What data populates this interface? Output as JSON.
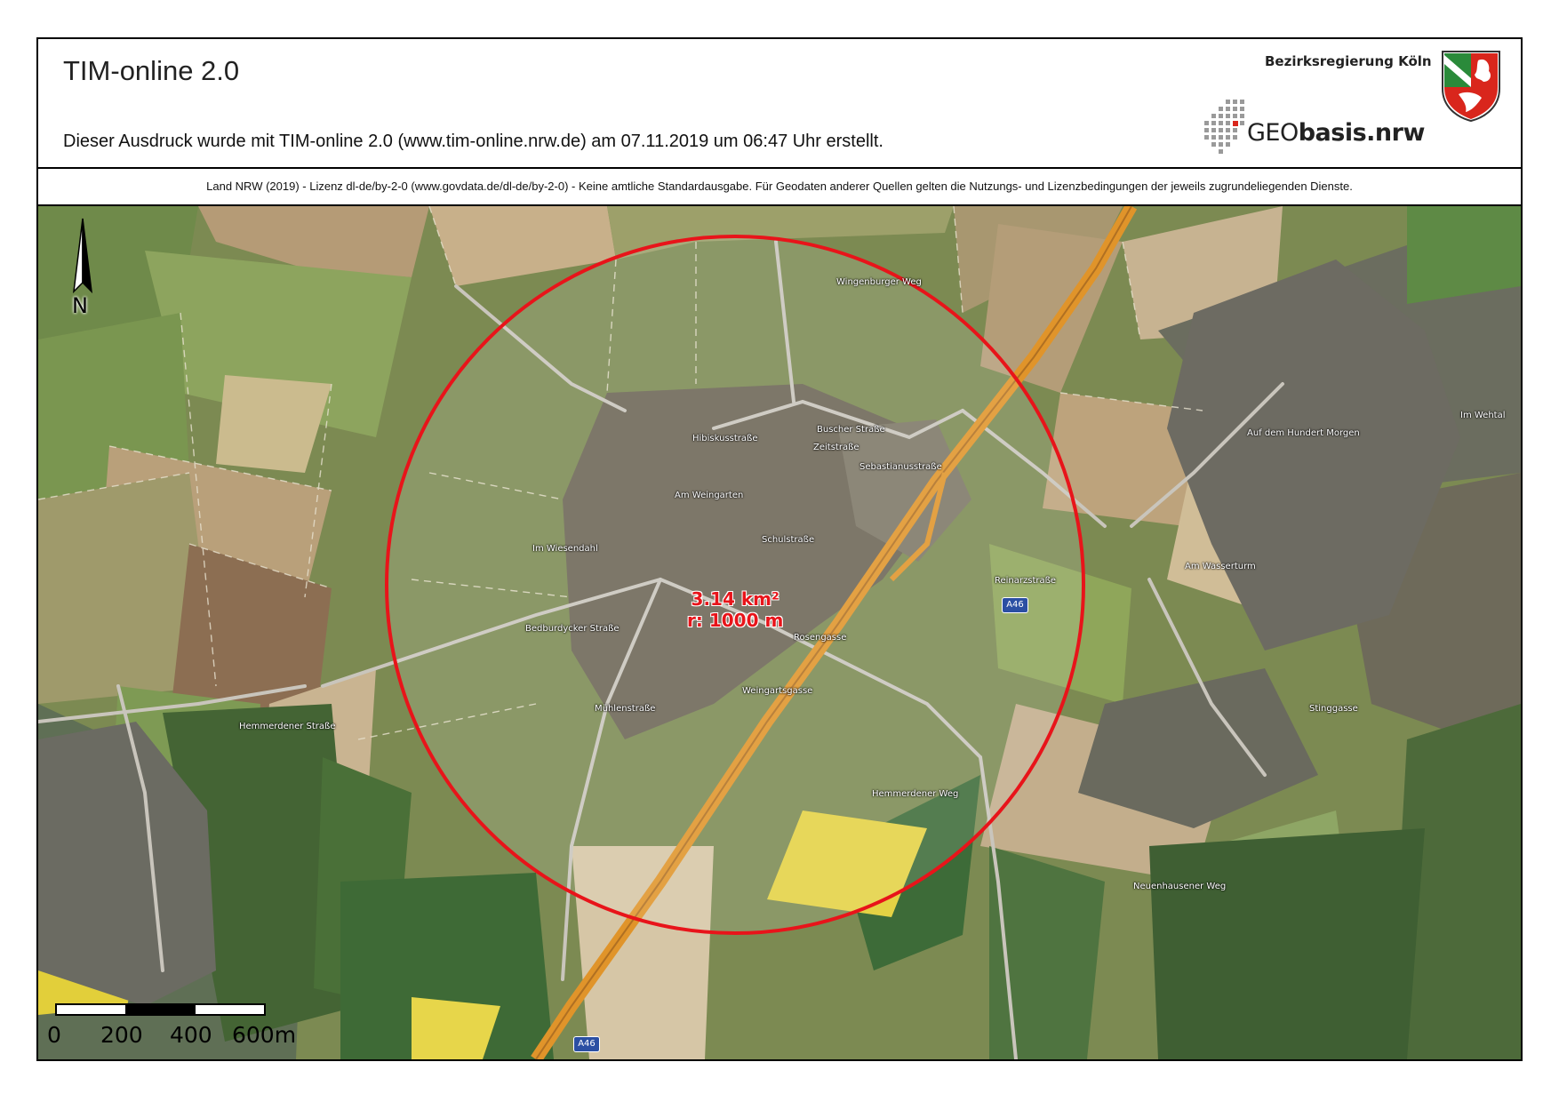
{
  "header": {
    "title": "TIM-online 2.0",
    "subtitle": "Dieser Ausdruck wurde mit TIM-online 2.0 (www.tim-online.nrw.de) am 07.11.2019 um 06:47 Uhr erstellt.",
    "authority": "Bezirksregierung Köln",
    "geobasis_prefix": "GEO",
    "geobasis_suffix": "basis.nrw"
  },
  "license": "Land NRW (2019) - Lizenz dl-de/by-2-0 (www.govdata.de/dl-de/by-2-0) - Keine amtliche Standardausgabe. Für Geodaten anderer Quellen gelten die Nutzungs- und Lizenzbedingungen der jeweils zugrundeliegenden Dienste.",
  "map": {
    "north_label": "N",
    "measurement": {
      "area": "3.14 km²",
      "radius": "r: 1000 m",
      "circle_color": "#e8141a"
    },
    "scale_bar": {
      "labels": [
        "0",
        "200",
        "400",
        "600m"
      ]
    },
    "motorway_shields": [
      "A46",
      "A46"
    ],
    "street_labels": [
      "Hibiskusstraße",
      "Buscher Straße",
      "Zeitstraße",
      "Sebastianusstraße",
      "Schulstraße",
      "Bedburdycker Straße",
      "Hemmerdener Straße",
      "Hemmerdener Weg",
      "Im Wiesendahl",
      "Rosengasse",
      "Weingartsgasse",
      "Am Weingarten",
      "Mühlenstraße",
      "Wingenburger Weg",
      "Neuenhausener Weg",
      "Auf dem Hundert Morgen",
      "Stinggasse",
      "Am Wasserturm",
      "Im Wehtal",
      "Reinarzstraße"
    ],
    "colors": {
      "motorway": "#e0942a",
      "circle": "#e8141a"
    }
  }
}
